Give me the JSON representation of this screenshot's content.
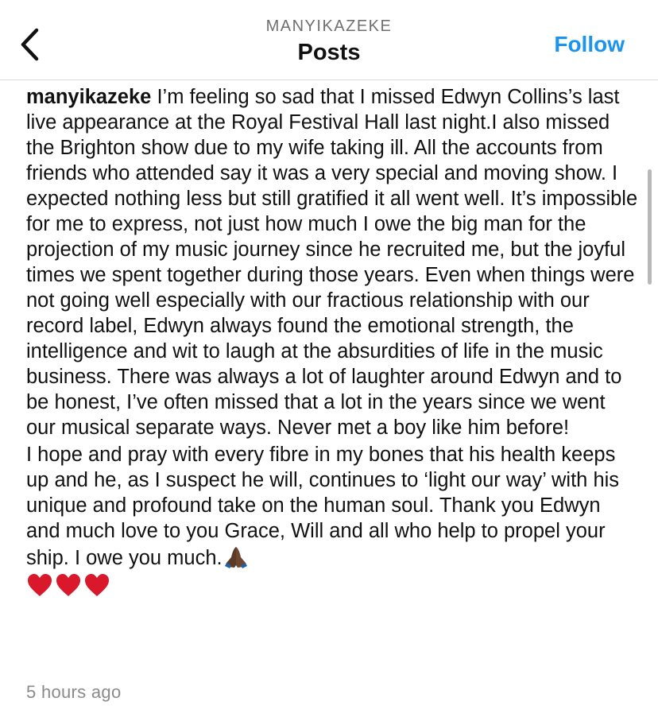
{
  "header": {
    "username": "MANYIKAZEKE",
    "title": "Posts",
    "follow_label": "Follow",
    "back_icon": "chevron-left-icon"
  },
  "post": {
    "username": "manyikazeke",
    "paragraph1": "I’m feeling so sad that I missed Edwyn Collins’s last live appearance at the Royal Festival Hall last night.I also missed the Brighton show due to my wife taking ill. All the accounts from friends who attended say it was a very special and moving show. I expected nothing less but still gratified it all went well. It’s impossible for me to express, not just how much I owe the big man for the projection of my music journey since he recruited me, but the joyful times we spent together during those years. Even when things were not going well especially with our fractious relationship with our record label, Edwyn always found the emotional strength, the intelligence and wit to laugh at the absurdities of life in the music business. There was always a lot of laughter around Edwyn and to be honest, I’ve often missed that a lot in the years since we went our musical separate ways. Never met a boy like him before!",
    "paragraph2": "I hope and pray with every fibre in my bones that his health keeps up and he, as I suspect he will, continues to ‘light our way’ with his unique and profound take on the human soul. Thank you Edwyn and much love to you Grace, Will and all who help to propel your ship. I owe you much.",
    "emoji_hands": "folded-hands-icon",
    "hearts_count": 3,
    "heart_icon": "red-heart-icon",
    "timestamp": "5 hours ago"
  },
  "colors": {
    "follow": "#1a94ee",
    "heart": "#d9182b",
    "muted": "#8a8a8a"
  }
}
